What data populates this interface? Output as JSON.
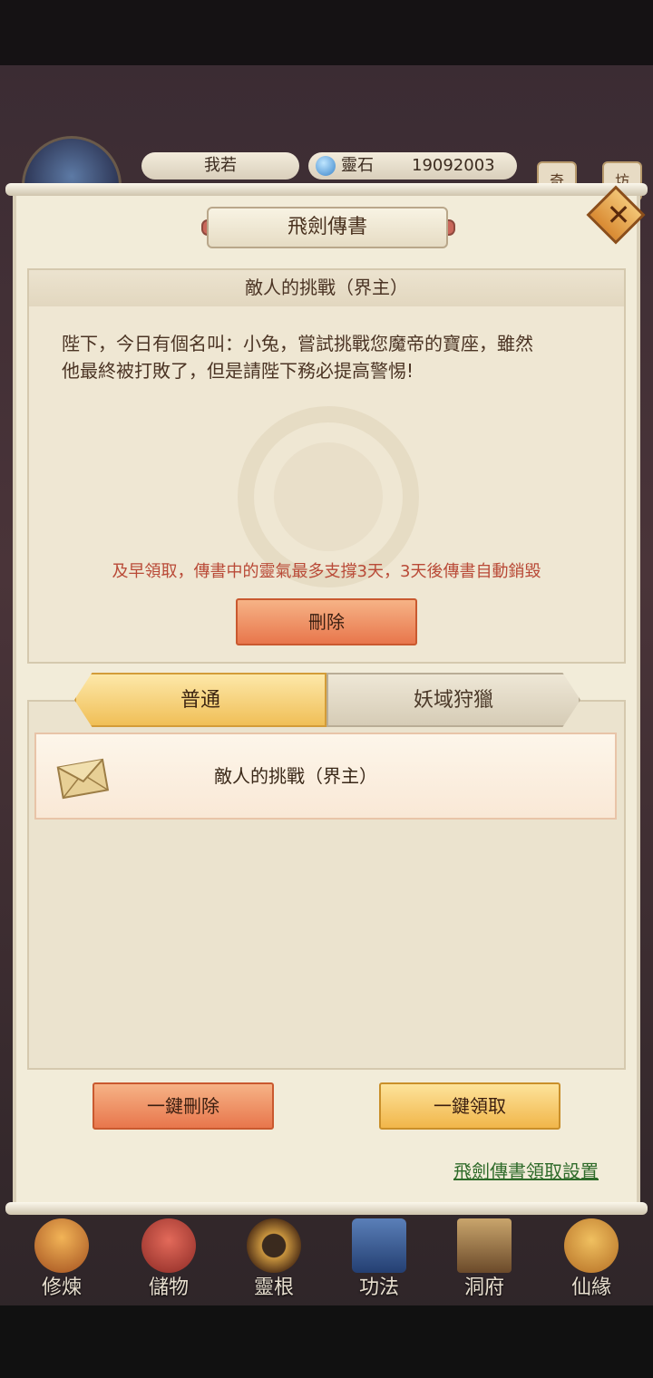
{
  "header": {
    "player_name": "我若",
    "currency_label": "靈石",
    "currency_value": "19092003",
    "side_buttons": [
      "奇",
      "坊"
    ]
  },
  "modal": {
    "title": "飛劍傳書",
    "close_icon": "close-icon",
    "detail": {
      "subject": "敵人的挑戰（界主）",
      "body_line1": "陛下，今日有個名叫：小兔，嘗試挑戰您魔帝的寶座，雖然",
      "body_line2": "他最終被打敗了，但是請陛下務必提高警惕!",
      "warning": "及早領取，傳書中的靈氣最多支撐3天，3天後傳書自動銷毀",
      "delete_label": "刪除"
    },
    "tabs": [
      {
        "label": "普通",
        "active": true
      },
      {
        "label": "妖域狩獵",
        "active": false
      }
    ],
    "mail_list": [
      {
        "icon": "envelope-icon",
        "subject": "敵人的挑戰（界主）"
      }
    ],
    "delete_all_label": "一鍵刪除",
    "claim_all_label": "一鍵領取",
    "settings_link": "飛劍傳書領取設置"
  },
  "bottom_nav": [
    {
      "label": "修煉",
      "icon": "monk-icon"
    },
    {
      "label": "儲物",
      "icon": "bag-icon"
    },
    {
      "label": "靈根",
      "icon": "spiral-icon"
    },
    {
      "label": "功法",
      "icon": "book-icon"
    },
    {
      "label": "洞府",
      "icon": "gate-icon"
    },
    {
      "label": "仙緣",
      "icon": "gourd-icon"
    }
  ],
  "colors": {
    "warning_text": "#b94a37",
    "link_text": "#2f6b2a",
    "accent_orange": "#e8764c",
    "accent_gold": "#f1b64a"
  }
}
